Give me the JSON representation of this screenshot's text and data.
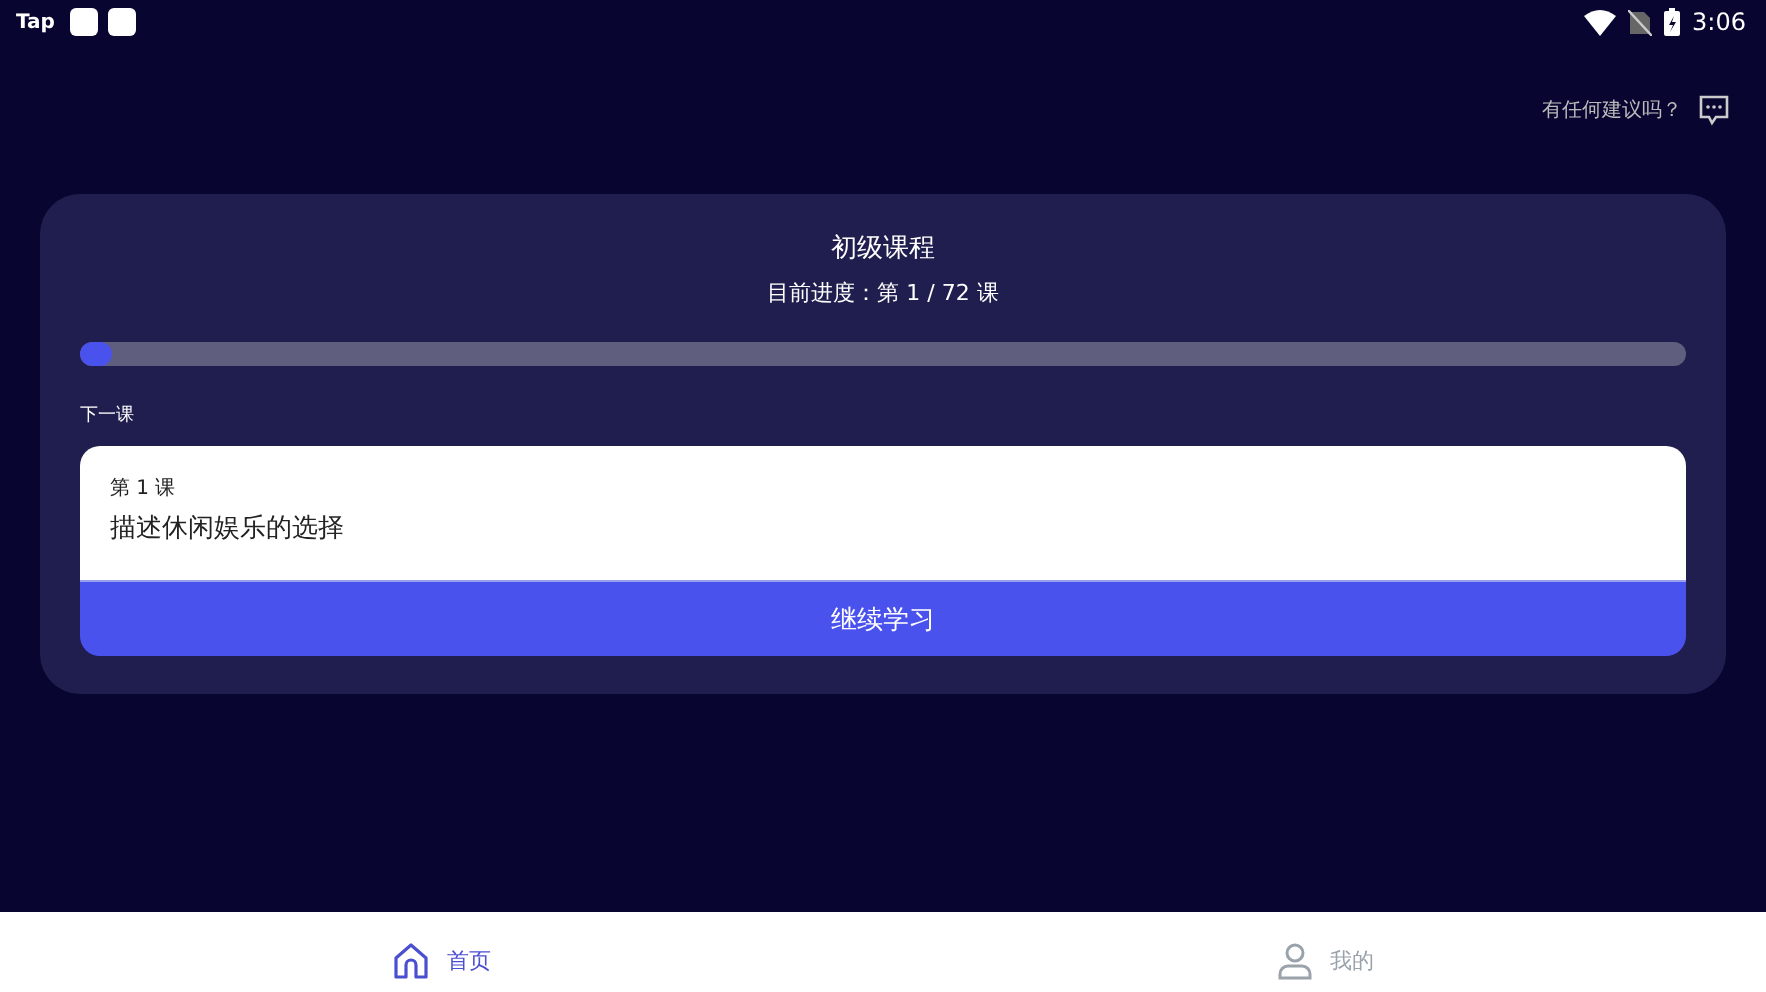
{
  "status_bar": {
    "app_label": "Tap",
    "time": "3:06"
  },
  "feedback": {
    "label": "有任何建议吗？"
  },
  "course": {
    "title": "初级课程",
    "progress_text": "目前进度：第 1 / 72 课",
    "level": 0.02
  },
  "next_lesson": {
    "heading": "下一课",
    "number": "第 1 课",
    "title": "描述休闲娱乐的选择",
    "button": "继续学习"
  },
  "nav": [
    {
      "kind": "home",
      "label": "首页",
      "selected": true
    },
    {
      "kind": "profile",
      "label": "我的",
      "selected": false
    }
  ]
}
